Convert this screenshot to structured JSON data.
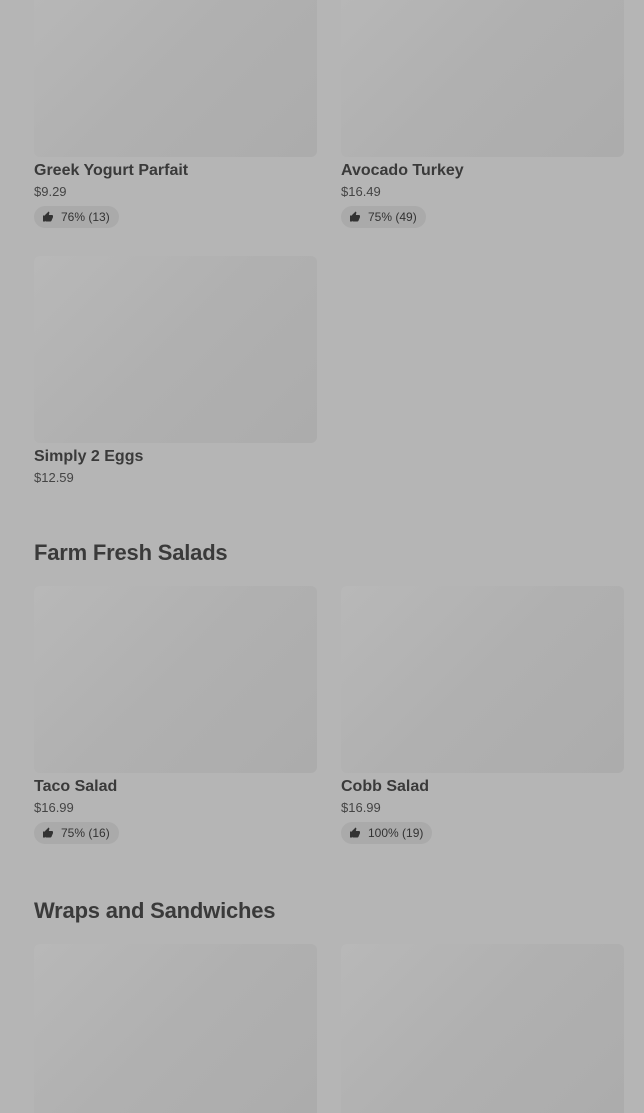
{
  "sections": [
    {
      "title": "",
      "items": [
        {
          "name": "Greek Yogurt Parfait",
          "price": "$9.29",
          "rating": "76% (13)"
        },
        {
          "name": "Avocado Turkey",
          "price": "$16.49",
          "rating": "75% (49)"
        },
        {
          "name": "Simply 2 Eggs",
          "price": "$12.59",
          "rating": ""
        }
      ]
    },
    {
      "title": "Farm Fresh Salads",
      "items": [
        {
          "name": "Taco Salad",
          "price": "$16.99",
          "rating": "75% (16)"
        },
        {
          "name": "Cobb Salad",
          "price": "$16.99",
          "rating": "100% (19)"
        }
      ]
    },
    {
      "title": "Wraps and Sandwiches",
      "items": [
        {
          "name": "",
          "price": "",
          "rating": ""
        },
        {
          "name": "",
          "price": "",
          "rating": ""
        }
      ]
    }
  ],
  "icons": {
    "rating": "thumbs-up-icon"
  }
}
